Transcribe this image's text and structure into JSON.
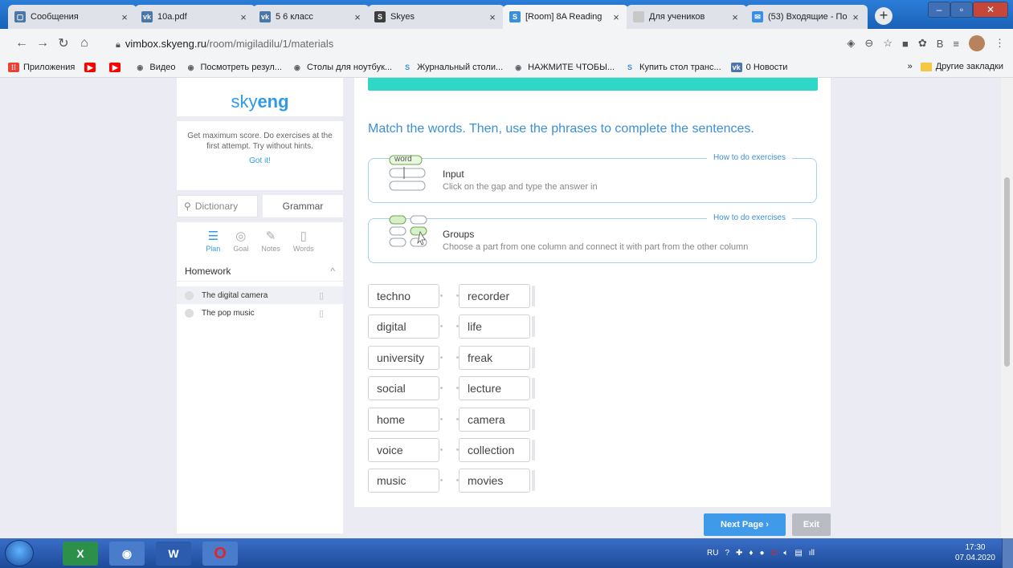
{
  "browser": {
    "tabs": [
      {
        "title": "Сообщения",
        "favicon": "vk-messages-icon",
        "fav_color": "#4a76a8",
        "fav_glyph": "▢"
      },
      {
        "title": "10a.pdf",
        "favicon": "vk-icon",
        "fav_color": "#4a76a8",
        "fav_glyph": "vk"
      },
      {
        "title": "5 6 класс",
        "favicon": "vk-icon",
        "fav_color": "#4a76a8",
        "fav_glyph": "vk"
      },
      {
        "title": "Skyes",
        "favicon": "skyeng-icon",
        "fav_color": "#3d3d3d",
        "fav_glyph": "S"
      },
      {
        "title": "[Room] 8A Reading",
        "favicon": "skyeng-icon",
        "fav_color": "#3b8fd9",
        "fav_glyph": "S"
      },
      {
        "title": "Для учеников",
        "favicon": "page-icon",
        "fav_color": "#c8c8c8",
        "fav_glyph": ""
      },
      {
        "title": "(53) Входящие - По",
        "favicon": "mail-icon",
        "fav_color": "#3a8ee6",
        "fav_glyph": "✉"
      }
    ],
    "active_tab": 4,
    "url_host": "vimbox.skyeng.ru",
    "url_path": "/room/migiladilu/1/materials"
  },
  "bookmarks": {
    "items": [
      {
        "label": "Приложения",
        "icon": "apps-icon"
      },
      {
        "label": "",
        "icon": "youtube-icon"
      },
      {
        "label": "",
        "icon": "youtube-icon"
      },
      {
        "label": "Видео",
        "icon": "globe-icon"
      },
      {
        "label": "Посмотреть резул...",
        "icon": "globe-icon"
      },
      {
        "label": "Столы для ноутбук...",
        "icon": "globe-icon"
      },
      {
        "label": "Журнальный столи...",
        "icon": "skyeng-icon"
      },
      {
        "label": "НАЖМИТЕ ЧТОБЫ...",
        "icon": "globe-icon"
      },
      {
        "label": "Купить стол транс...",
        "icon": "skyeng-icon"
      },
      {
        "label": "0 Новости",
        "icon": "vk-icon"
      }
    ],
    "more": "»",
    "other": "Другие закладки"
  },
  "sidebar": {
    "logo_a": "sky",
    "logo_b": "eng",
    "tip": "Get maximum score. Do exercises at the first attempt. Try without hints.",
    "tip_action": "Got it!",
    "dictionary_placeholder": "Dictionary",
    "grammar": "Grammar",
    "tabs": [
      {
        "label": "Plan",
        "icon": "plan-icon",
        "glyph": "☰"
      },
      {
        "label": "Goal",
        "icon": "goal-icon",
        "glyph": "◎"
      },
      {
        "label": "Notes",
        "icon": "pencil-icon",
        "glyph": "✎"
      },
      {
        "label": "Words",
        "icon": "book-icon",
        "glyph": "▯"
      }
    ],
    "section": "Homework",
    "lessons": [
      {
        "title": "The digital camera"
      },
      {
        "title": "The pop music"
      }
    ]
  },
  "exercise": {
    "heading": "Match the words. Then, use the phrases to complete the sentences.",
    "help": [
      {
        "title": "Input",
        "text": "Click on the gap and type the answer in",
        "link": "How to do exercises",
        "badge": "word"
      },
      {
        "title": "Groups",
        "text": "Choose a part from one column and connect it with part from the other column",
        "link": "How to do exercises"
      }
    ],
    "left_words": [
      "techno",
      "digital",
      "university",
      "social",
      "home",
      "voice",
      "music"
    ],
    "right_words": [
      "recorder",
      "life",
      "freak",
      "lecture",
      "camera",
      "collection",
      "movies"
    ]
  },
  "footer": {
    "next": "Next Page ›",
    "exit": "Exit"
  },
  "taskbar": {
    "lang": "RU",
    "time": "17:30",
    "date": "07.04.2020"
  }
}
